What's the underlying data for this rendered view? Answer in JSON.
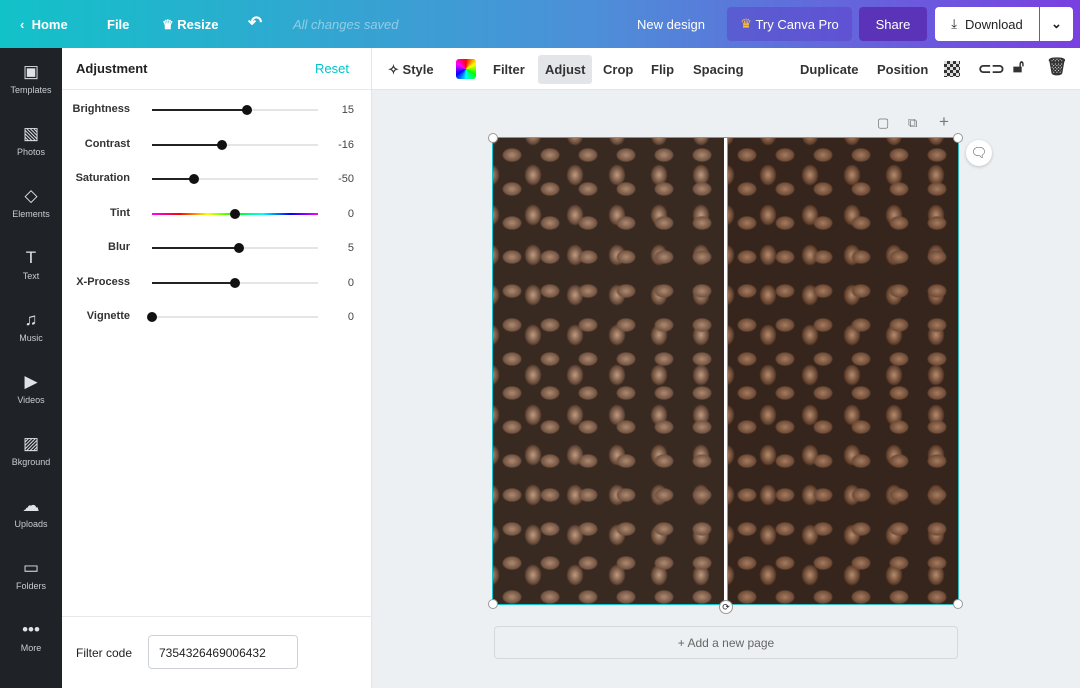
{
  "header": {
    "home": "Home",
    "file": "File",
    "resize": "Resize",
    "status": "All changes saved",
    "new_design": "New design",
    "try_pro": "Try Canva Pro",
    "share": "Share",
    "download": "Download"
  },
  "sidebar": {
    "items": [
      {
        "label": "Templates",
        "icon": "▣"
      },
      {
        "label": "Photos",
        "icon": "▧"
      },
      {
        "label": "Elements",
        "icon": "◇"
      },
      {
        "label": "Text",
        "icon": "T"
      },
      {
        "label": "Music",
        "icon": "♫"
      },
      {
        "label": "Videos",
        "icon": "▶"
      },
      {
        "label": "Bkground",
        "icon": "▨"
      },
      {
        "label": "Uploads",
        "icon": "☁"
      },
      {
        "label": "Folders",
        "icon": "▭"
      },
      {
        "label": "More",
        "icon": "•••"
      }
    ]
  },
  "panel": {
    "title": "Adjustment",
    "reset": "Reset",
    "sliders": [
      {
        "label": "Brightness",
        "value": 15,
        "min": -100,
        "max": 100
      },
      {
        "label": "Contrast",
        "value": -16,
        "min": -100,
        "max": 100
      },
      {
        "label": "Saturation",
        "value": -50,
        "min": -100,
        "max": 100
      },
      {
        "label": "Tint",
        "value": 0,
        "min": -100,
        "max": 100
      },
      {
        "label": "Blur",
        "value": 5,
        "min": -100,
        "max": 100
      },
      {
        "label": "X-Process",
        "value": 0,
        "min": -100,
        "max": 100
      },
      {
        "label": "Vignette",
        "value": 0,
        "min": 0,
        "max": 100
      }
    ],
    "filter_code_label": "Filter code",
    "filter_code": "7354326469006432"
  },
  "toolbar": {
    "style": "Style",
    "filter": "Filter",
    "adjust": "Adjust",
    "crop": "Crop",
    "flip": "Flip",
    "spacing": "Spacing",
    "duplicate": "Duplicate",
    "position": "Position"
  },
  "canvas": {
    "add_page": "+ Add a new page"
  },
  "colors": {
    "accent": "#00c4cc",
    "rail": "#1f2328"
  }
}
